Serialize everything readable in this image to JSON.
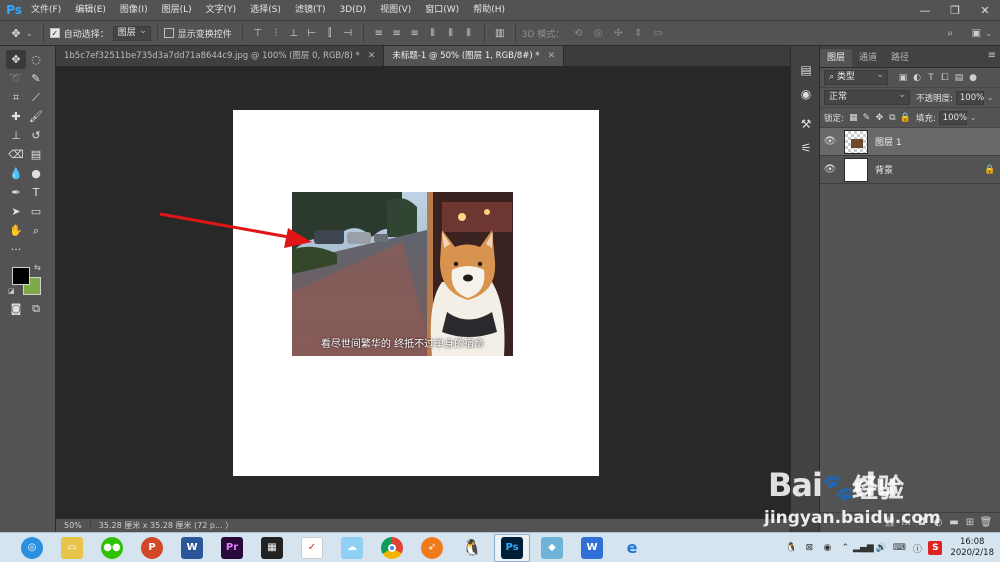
{
  "menubar": {
    "logo": "Ps",
    "items": [
      "文件(F)",
      "编辑(E)",
      "图像(I)",
      "图层(L)",
      "文字(Y)",
      "选择(S)",
      "滤镜(T)",
      "3D(D)",
      "视图(V)",
      "窗口(W)",
      "帮助(H)"
    ],
    "window_controls": [
      "—",
      "❐",
      "✕"
    ]
  },
  "options": {
    "auto_select_label": "自动选择：",
    "auto_select_value": "图层",
    "show_transform_label": "显示变换控件",
    "mode_3d_label": "3D 模式："
  },
  "tabs": [
    {
      "label": "1b5c7ef32511be735d3a7dd71a8644c9.jpg @ 100% (图层 0, RGB/8) *",
      "active": false
    },
    {
      "label": "未标题-1 @ 50% (图层 1, RGB/8#) *",
      "active": true
    }
  ],
  "canvas": {
    "caption": "看尽世间繁华的 终抵不过单身的宿命"
  },
  "status": {
    "zoom": "50%",
    "doc_size": "35.28 厘米 x 35.28 厘米 (72 p... 〉"
  },
  "panel": {
    "tabs": [
      "图层",
      "通道",
      "路径"
    ],
    "filter_kind": "类型",
    "blend_mode": "正常",
    "opacity_label": "不透明度:",
    "opacity_value": "100%",
    "lock_label": "锁定:",
    "fill_label": "填充:",
    "fill_value": "100%",
    "layers": [
      {
        "name": "图层 1",
        "selected": true,
        "locked": false
      },
      {
        "name": "背景",
        "selected": false,
        "locked": true
      }
    ]
  },
  "watermark": {
    "logo_text": "Bai",
    "logo_text2": "du",
    "brand": "经验",
    "url": "jingyan.baidu.com"
  },
  "tray": {
    "time": "16:08",
    "date": "2020/2/18"
  },
  "colors": {
    "foreground": "#000000",
    "background": "#7faa49",
    "arrow": "#e01515"
  }
}
